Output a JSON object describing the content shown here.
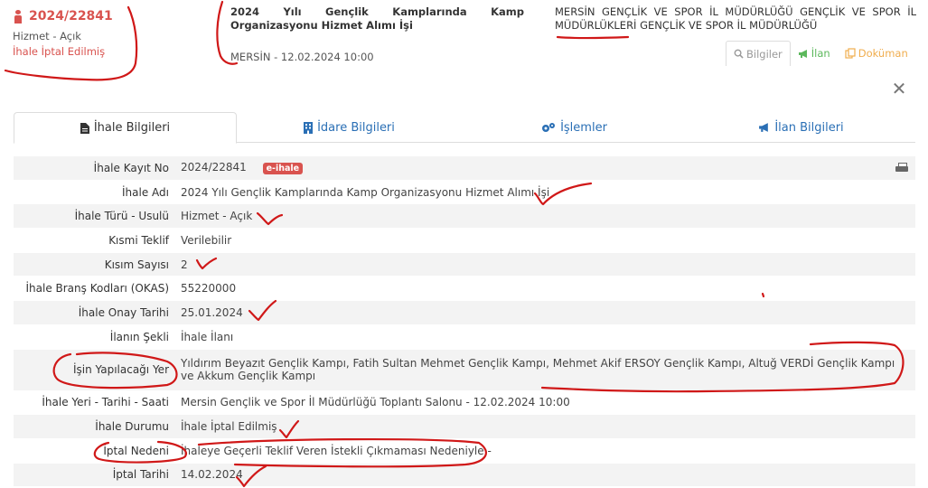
{
  "header": {
    "ihale_no": "2024/22841",
    "sub": "Hizmet - Açık",
    "status": "İhale İptal Edilmiş",
    "title": "2024 Yılı Gençlik Kamplarında Kamp Organizasyonu Hizmet Alımı İşi",
    "location": "MERSİN - 12.02.2024 10:00",
    "org": "MERSİN GENÇLİK VE SPOR İL MÜDÜRLÜĞÜ GENÇLİK VE SPOR İL MÜDÜRLÜKLERİ GENÇLİK VE SPOR İL MÜDÜRLÜĞÜ",
    "buttons": {
      "bilgiler": "Bilgiler",
      "ilan": "İlan",
      "dokuman": "Doküman"
    },
    "close": "✕"
  },
  "tabs": [
    {
      "label": "İhale Bilgileri"
    },
    {
      "label": "İdare Bilgileri"
    },
    {
      "label": "İşlemler"
    },
    {
      "label": "İlan Bilgileri"
    }
  ],
  "details": {
    "badge": "e-ihale",
    "rows": [
      {
        "label": "İhale Kayıt No",
        "value": "2024/22841"
      },
      {
        "label": "İhale Adı",
        "value": "2024 Yılı Gençlik Kamplarında Kamp Organizasyonu Hizmet Alımı İşi"
      },
      {
        "label": "İhale Türü - Usulü",
        "value": "Hizmet - Açık"
      },
      {
        "label": "Kısmi Teklif",
        "value": "Verilebilir"
      },
      {
        "label": "Kısım Sayısı",
        "value": "2"
      },
      {
        "label": "İhale Branş Kodları (OKAS)",
        "value": "55220000"
      },
      {
        "label": "İhale Onay Tarihi",
        "value": "25.01.2024"
      },
      {
        "label": "İlanın Şekli",
        "value": "İhale İlanı"
      },
      {
        "label": "İşin Yapılacağı Yer",
        "value": "Yıldırım Beyazıt Gençlik Kampı, Fatih Sultan Mehmet Gençlik Kampı, Mehmet Akif ERSOY Gençlik Kampı, Altuğ VERDİ Gençlik Kampı ve Akkum Gençlik Kampı"
      },
      {
        "label": "İhale Yeri - Tarihi - Saati",
        "value": "Mersin Gençlik ve Spor İl Müdürlüğü Toplantı Salonu - 12.02.2024 10:00"
      },
      {
        "label": "İhale Durumu",
        "value": "İhale İptal Edilmiş"
      },
      {
        "label": "İptal Nedeni",
        "value": "İhaleye Geçerli Teklif Veren İstekli Çıkmaması Nedeniyle -"
      },
      {
        "label": "İptal Tarihi",
        "value": "14.02.2024"
      }
    ]
  },
  "colors": {
    "danger": "#d9534f",
    "link": "#2a6fb5",
    "success": "#5cb85c",
    "warning": "#f0ad4e",
    "annotation": "#d01818"
  },
  "icons": [
    "person-icon",
    "search-icon",
    "megaphone-icon",
    "files-icon",
    "close-icon",
    "document-icon",
    "building-icon",
    "gears-icon",
    "print-icon"
  ]
}
